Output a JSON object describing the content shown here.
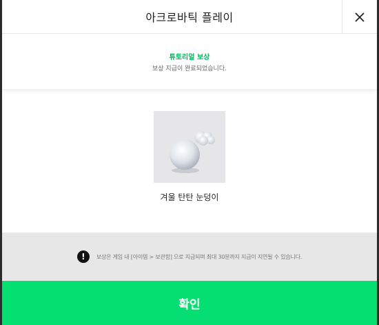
{
  "dialog": {
    "title": "아크로바틱 플레이",
    "close_icon": "close-icon"
  },
  "info": {
    "subtitle": "튜토리얼 보상",
    "description": "보상 지급이 완료되었습니다."
  },
  "reward": {
    "item_name": "겨울 탄탄 눈덩이",
    "item_icon": "snowball-icon"
  },
  "notice": {
    "icon": "exclamation-icon",
    "icon_glyph": "!",
    "text": "보상은 게임 내 [아이템 > 보관함] 으로 지급되며 최대 30분까지 지급이 지연될 수 있습니다."
  },
  "footer": {
    "confirm_label": "확인"
  },
  "colors": {
    "accent": "#05df72",
    "subtitle": "#00b95a",
    "notice_bg": "#e7e7e7"
  }
}
